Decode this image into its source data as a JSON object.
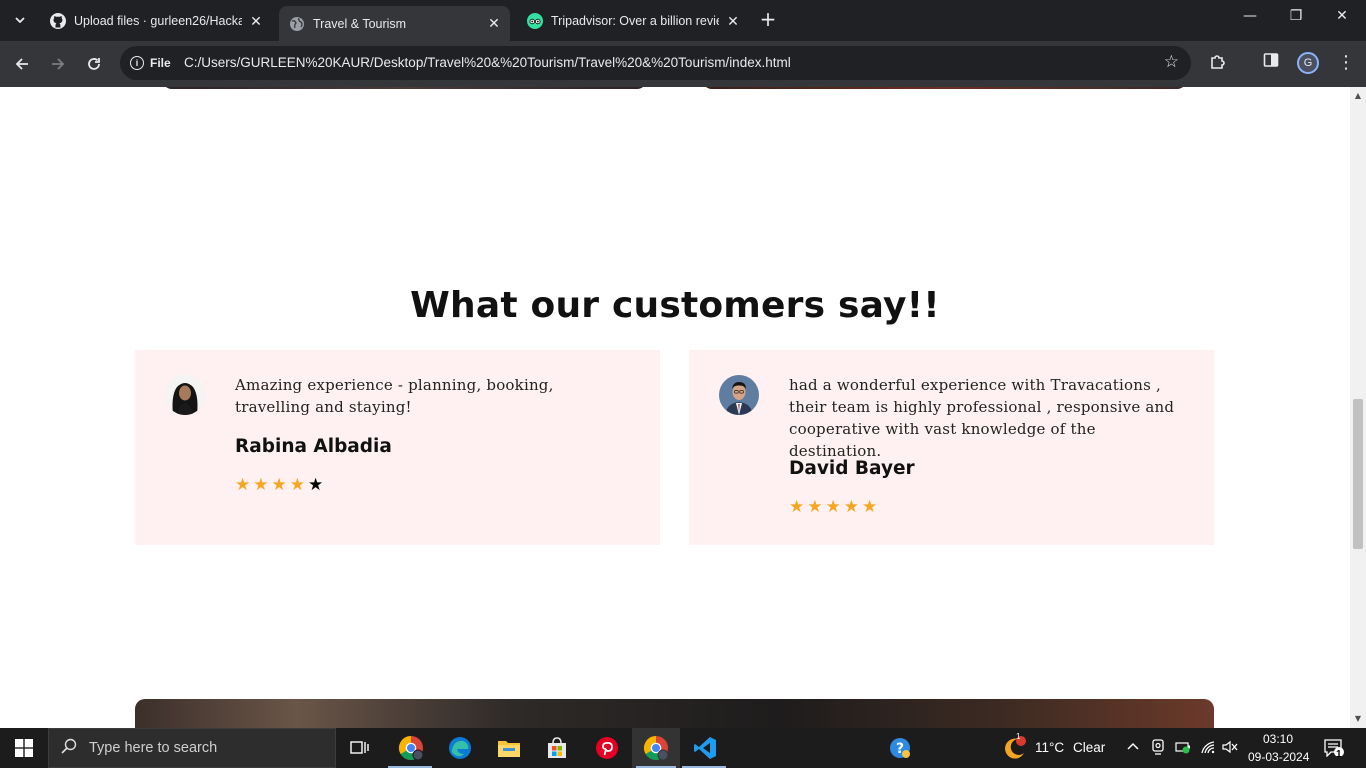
{
  "browser": {
    "tabs": [
      {
        "title": "Upload files · gurleen26/Hackat",
        "favicon": "github-icon",
        "active": false
      },
      {
        "title": "Travel & Tourism",
        "favicon": "globe-icon",
        "active": true
      },
      {
        "title": "Tripadvisor: Over a billion review",
        "favicon": "tripadvisor-icon",
        "active": false
      }
    ],
    "address_chip": "File",
    "url": "C:/Users/GURLEEN%20KAUR/Desktop/Travel%20&%20Tourism/Travel%20&%20Tourism/index.html",
    "profile_initial": "G"
  },
  "page": {
    "section_title": "What our customers say!!",
    "testimonials": [
      {
        "quote": "Amazing experience - planning, booking, travelling and staying!",
        "name": "Rabina Albadia",
        "rating": 4,
        "max_rating": 5
      },
      {
        "quote": "had a wonderful experience with Travacations , their team is highly professional , responsive and cooperative with vast knowledge of the destination.",
        "name": "David Bayer",
        "rating": 5,
        "max_rating": 5
      }
    ],
    "colors": {
      "card_bg": "#fff1f1",
      "star_on": "#f5a623",
      "star_off": "#000000"
    }
  },
  "taskbar": {
    "search_placeholder": "Type here to search",
    "weather_temp": "11°C",
    "weather_desc": "Clear",
    "time": "03:10",
    "date": "09-03-2024",
    "notification_count": "1",
    "weather_badge": "1"
  }
}
